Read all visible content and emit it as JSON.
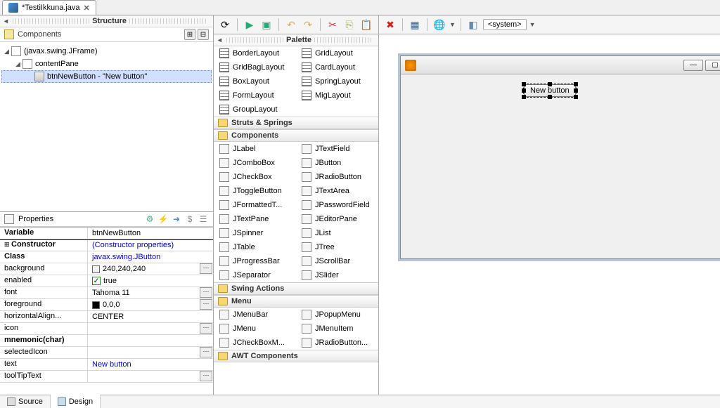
{
  "tab": {
    "title": "*TestiIkkuna.java"
  },
  "structure": {
    "title": "Structure",
    "components_label": "Components",
    "nodes": [
      "(javax.swing.JFrame)",
      "contentPane",
      "btnNewButton - \"New button\""
    ]
  },
  "properties_panel": {
    "title": "Properties",
    "rows": [
      {
        "key": "Variable",
        "val": "btnNewButton",
        "bold": true,
        "link": false
      },
      {
        "key": "Constructor",
        "val": "(Constructor properties)",
        "bold": true,
        "link": true
      },
      {
        "key": "Class",
        "val": "javax.swing.JButton",
        "bold": true,
        "link": true
      },
      {
        "key": "background",
        "val": "240,240,240",
        "swatch": "#f0f0f0",
        "btn": true
      },
      {
        "key": "enabled",
        "val": "true",
        "check": true
      },
      {
        "key": "font",
        "val": "Tahoma 11",
        "btn": true
      },
      {
        "key": "foreground",
        "val": "0,0,0",
        "swatch": "#000000",
        "btn": true
      },
      {
        "key": "horizontalAlign...",
        "val": "CENTER"
      },
      {
        "key": "icon",
        "val": "",
        "btn": true
      },
      {
        "key": "mnemonic(char)",
        "val": "",
        "bold": true
      },
      {
        "key": "selectedIcon",
        "val": "",
        "btn": true
      },
      {
        "key": "text",
        "val": "New button",
        "bold": false,
        "link": true
      },
      {
        "key": "toolTipText",
        "val": "",
        "btn": true
      }
    ]
  },
  "toolbar": {
    "system_label": "<system>"
  },
  "palette": {
    "title": "Palette",
    "layouts": [
      [
        "BorderLayout",
        "GridLayout"
      ],
      [
        "GridBagLayout",
        "CardLayout"
      ],
      [
        "BoxLayout",
        "SpringLayout"
      ],
      [
        "FormLayout",
        "MigLayout"
      ],
      [
        "GroupLayout",
        ""
      ]
    ],
    "cat_struts": "Struts & Springs",
    "cat_components": "Components",
    "components": [
      [
        "JLabel",
        "JTextField"
      ],
      [
        "JComboBox",
        "JButton"
      ],
      [
        "JCheckBox",
        "JRadioButton"
      ],
      [
        "JToggleButton",
        "JTextArea"
      ],
      [
        "JFormattedT...",
        "JPasswordField"
      ],
      [
        "JTextPane",
        "JEditorPane"
      ],
      [
        "JSpinner",
        "JList"
      ],
      [
        "JTable",
        "JTree"
      ],
      [
        "JProgressBar",
        "JScrollBar"
      ],
      [
        "JSeparator",
        "JSlider"
      ]
    ],
    "cat_swing_actions": "Swing Actions",
    "cat_menu": "Menu",
    "menu": [
      [
        "JMenuBar",
        "JPopupMenu"
      ],
      [
        "JMenu",
        "JMenuItem"
      ],
      [
        "JCheckBoxM...",
        "JRadioButton..."
      ]
    ],
    "cat_awt": "AWT Components"
  },
  "designer": {
    "button_text": "New button"
  },
  "footer": {
    "source": "Source",
    "design": "Design"
  }
}
